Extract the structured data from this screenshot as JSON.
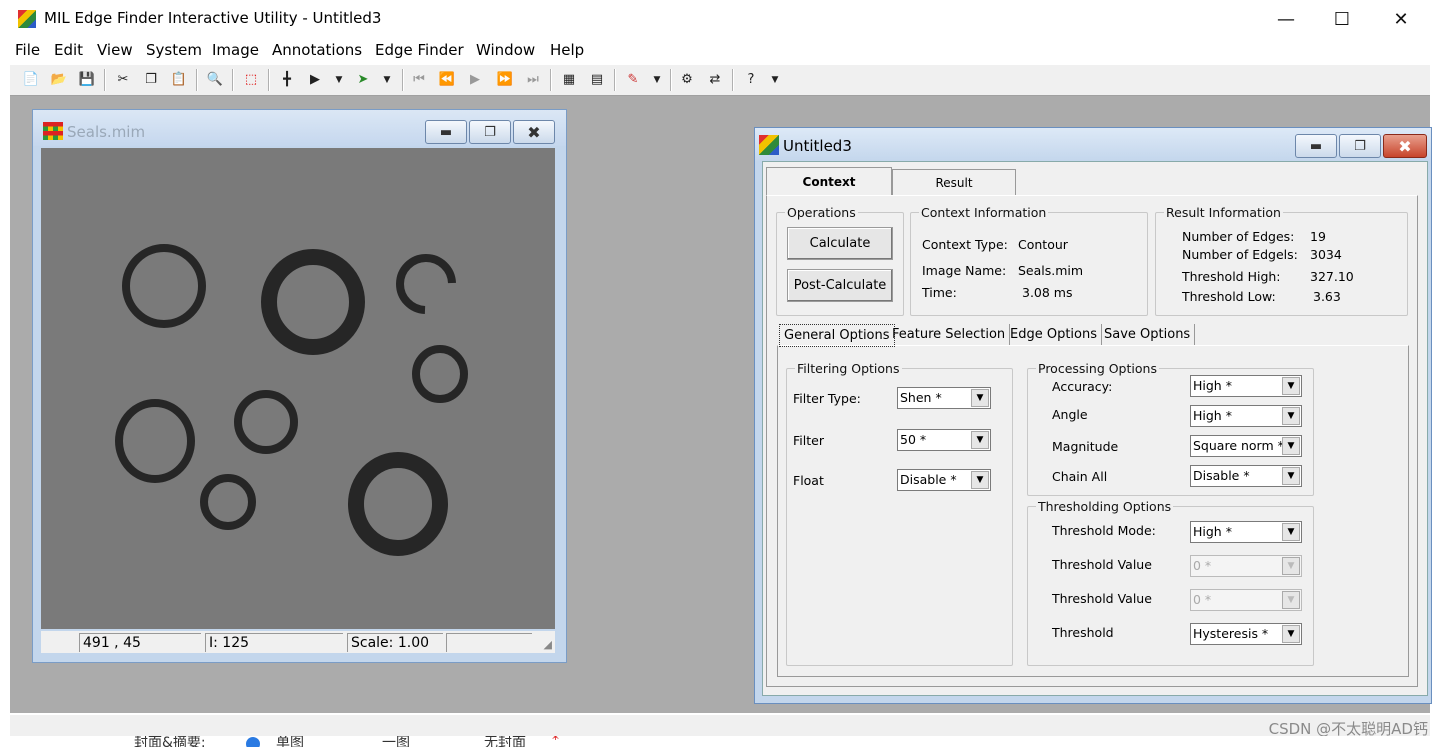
{
  "window": {
    "title": "MIL Edge Finder Interactive Utility - Untitled3"
  },
  "menubar": [
    {
      "label": "File"
    },
    {
      "label": "Edit"
    },
    {
      "label": "View"
    },
    {
      "label": "System"
    },
    {
      "label": "Image"
    },
    {
      "label": "Annotations"
    },
    {
      "label": "Edge Finder"
    },
    {
      "label": "Window"
    },
    {
      "label": "Help"
    }
  ],
  "image_window": {
    "title": "Seals.mim",
    "status": {
      "coords": "491 , 45",
      "intensity": "I: 125",
      "scale": "Scale: 1.00"
    }
  },
  "dialog": {
    "title": "Untitled3",
    "tabs": [
      {
        "label": "Context"
      },
      {
        "label": "Result"
      }
    ],
    "operations": {
      "title": "Operations",
      "calculate": "Calculate",
      "post_calculate": "Post-Calculate"
    },
    "context_info": {
      "title": "Context Information",
      "type_label": "Context Type:",
      "type_value": "Contour",
      "image_label": "Image Name:",
      "image_value": "Seals.mim",
      "time_label": "Time:",
      "time_value": "3.08 ms"
    },
    "result_info": {
      "title": "Result Information",
      "edges_label": "Number of Edges:",
      "edges_value": "19",
      "edgels_label": "Number of Edgels:",
      "edgels_value": "3034",
      "th_high_label": "Threshold High:",
      "th_high_value": "327.10",
      "th_low_label": "Threshold Low:",
      "th_low_value": "3.63"
    },
    "option_tabs": [
      {
        "label": "General Options"
      },
      {
        "label": "Feature Selection"
      },
      {
        "label": "Edge Options"
      },
      {
        "label": "Save Options"
      }
    ],
    "filtering": {
      "title": "Filtering Options",
      "filter_type_label": "Filter Type:",
      "filter_type_value": "Shen *",
      "filter_label": "Filter",
      "filter_value": "50 *",
      "float_label": "Float",
      "float_value": "Disable *"
    },
    "processing": {
      "title": "Processing Options",
      "accuracy_label": "Accuracy:",
      "accuracy_value": "High *",
      "angle_label": "Angle",
      "angle_value": "High *",
      "magnitude_label": "Magnitude",
      "magnitude_value": "Square norm *",
      "chain_label": "Chain All",
      "chain_value": "Disable *"
    },
    "thresholding": {
      "title": "Thresholding Options",
      "mode_label": "Threshold Mode:",
      "mode_value": "High *",
      "value1_label": "Threshold Value",
      "value1_value": "0 *",
      "value2_label": "Threshold Value",
      "value2_value": "0 *",
      "threshold_label": "Threshold",
      "threshold_value": "Hysteresis *"
    }
  },
  "bottom_strip": [
    "封面&摘要:",
    "单图",
    "一图",
    "无封面",
    "*"
  ],
  "watermark": "CSDN @不太聪明AD钙"
}
